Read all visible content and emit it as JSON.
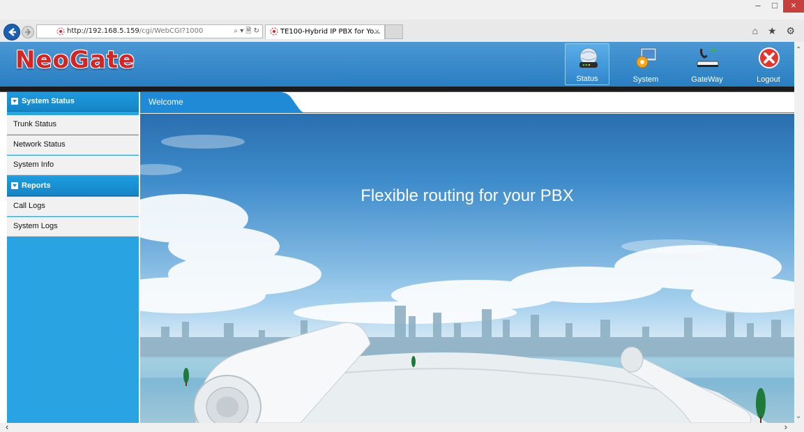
{
  "browser": {
    "url_host": "http://192.168.5.159",
    "url_path": "/cgi/WebCGI?1000",
    "search_glyph": "⌕ ▾ 🗎 ↻",
    "tab_title": "TE100-Hybrid IP PBX for Yo...",
    "tab_close": "×",
    "window_min": "–",
    "window_max": "□",
    "window_close": "×",
    "home_star_gear": "⌂ ★ ⚙"
  },
  "header": {
    "logo_text": "NeoGate",
    "nav": [
      {
        "label": "Status",
        "icon": "status-globe-icon",
        "active": true
      },
      {
        "label": "System",
        "icon": "system-monitor-gear-icon",
        "active": false
      },
      {
        "label": "GateWay",
        "icon": "gateway-phone-device-icon",
        "active": false
      },
      {
        "label": "Logout",
        "icon": "logout-red-x-icon",
        "active": false
      }
    ]
  },
  "sidebar": {
    "sections": [
      {
        "title": "System Status",
        "items": [
          "Trunk Status",
          "Network Status",
          "System Info"
        ]
      },
      {
        "title": "Reports",
        "items": [
          "Call Logs",
          "System Logs"
        ]
      }
    ]
  },
  "main": {
    "tab_label": "Welcome",
    "banner_headline": "Flexible routing for your PBX"
  },
  "colors": {
    "header_blue": "#2a83c9",
    "sidebar_blue": "#29a3e2",
    "logo_red": "#d42424",
    "tab_blue": "#1f8ad6"
  }
}
